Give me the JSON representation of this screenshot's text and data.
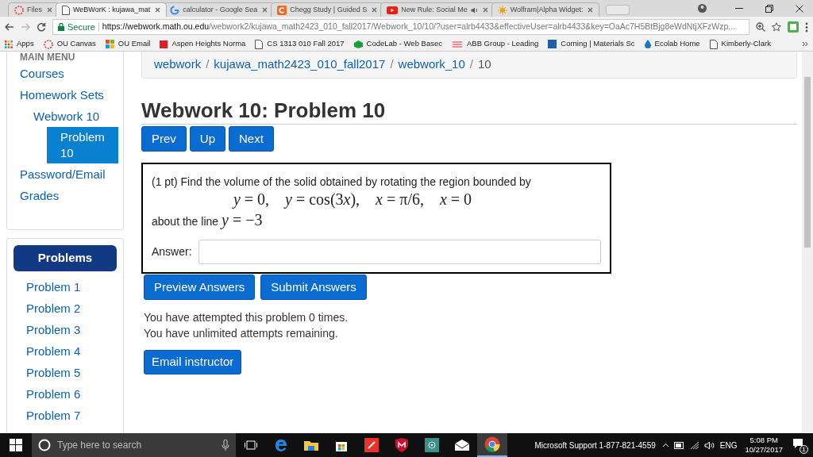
{
  "browser": {
    "tabs": [
      {
        "kind": "files",
        "title": "Files",
        "selected": false,
        "audio": false
      },
      {
        "kind": "doc",
        "title": "WeBWorK : kujawa_mat",
        "selected": true,
        "audio": false
      },
      {
        "kind": "google",
        "title": "calculator - Google Sea",
        "selected": false,
        "audio": false
      },
      {
        "kind": "chegg",
        "title": "Chegg Study | Guided S",
        "selected": false,
        "audio": false
      },
      {
        "kind": "youtube",
        "title": "New Rule: Social Me",
        "selected": false,
        "audio": true
      },
      {
        "kind": "sun",
        "title": "Wolfram|Alpha Widget:",
        "selected": false,
        "audio": false
      }
    ],
    "secure_label": "Secure",
    "url_host": "https://webwork.math.ou.edu",
    "url_path": "/webwork2/kujawa_math2423_010_fall2017/Webwork_10/10/?user=alrb4433&effectiveUser=alrb4433&key=OaAc7H5BtBjg8eWdNtjXFzWzp...",
    "bookmarks": [
      {
        "kind": "apps",
        "label": "Apps"
      },
      {
        "kind": "files",
        "label": "OU Canvas"
      },
      {
        "kind": "windows",
        "label": "OU Email"
      },
      {
        "kind": "square",
        "label": "Aspen Heights Norma"
      },
      {
        "kind": "doc",
        "label": "CS 1313 010 Fall 2017"
      },
      {
        "kind": "codelab",
        "label": "CodeLab - Web Basec"
      },
      {
        "kind": "abb",
        "label": "ABB Group - Leading"
      },
      {
        "kind": "corning",
        "label": "Corning | Materials Sc"
      },
      {
        "kind": "drop",
        "label": "Ecolab Home"
      },
      {
        "kind": "doc",
        "label": "Kimberly-Clark"
      }
    ]
  },
  "sidebar": {
    "menu_title": "MAIN MENU",
    "menu": [
      {
        "label": "Courses",
        "selected": false
      },
      {
        "label": "Homework Sets",
        "selected": false,
        "children": [
          {
            "label": "Webwork 10",
            "selected": false,
            "children": [
              {
                "label": "Problem 10",
                "selected": true
              }
            ]
          }
        ]
      },
      {
        "label": "Password/Email",
        "selected": false
      },
      {
        "label": "Grades",
        "selected": false
      }
    ],
    "problems_header": "Problems",
    "problems": [
      "Problem 1",
      "Problem 2",
      "Problem 3",
      "Problem 4",
      "Problem 5",
      "Problem 6",
      "Problem 7"
    ]
  },
  "breadcrumb": [
    "webwork",
    "kujawa_math2423_010_fall2017",
    "webwork_10",
    "10"
  ],
  "breadcrumb_separators": [
    "/",
    "/",
    "/"
  ],
  "title": "Webwork 10: Problem 10",
  "nav_buttons": [
    "Prev",
    "Up",
    "Next"
  ],
  "problem": {
    "statement": "(1 pt) Find the volume of the solid obtained by rotating the region bounded by",
    "equations": [
      "y = 0,",
      "y = cos(3x),",
      "x = π/6,",
      "x = 0"
    ],
    "about_label": "about the line",
    "about_math": "y = −3",
    "answer_label": "Answer:"
  },
  "action_buttons": [
    "Preview Answers",
    "Submit Answers"
  ],
  "messages": [
    "You have attempted this problem 0 times.",
    "You have unlimited attempts remaining."
  ],
  "email_button": "Email instructor",
  "taskbar": {
    "search_placeholder": "Type here to search",
    "support": "Microsoft Support 1-877-821-4559",
    "language": "ENG",
    "time": "5:08 PM",
    "date": "10/27/2017",
    "notifications": "1"
  }
}
